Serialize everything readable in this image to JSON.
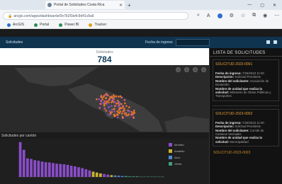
{
  "browser": {
    "tab_title": "Portal de Solicitudes Costa Rica",
    "url": "arcgis.com/apps/dashboards/0e7b2f3a4c9d41c8a6",
    "bookmarks": [
      "ArcGIS",
      "Portal",
      "Power BI",
      "Tracker"
    ]
  },
  "header": {
    "title": "Solicitudes",
    "filter_label": "Fecha de ingreso"
  },
  "kpi": {
    "label": "Solicitudes",
    "value": "784"
  },
  "chart": {
    "title": "Solicitudes por cantón"
  },
  "chart_data": {
    "type": "bar",
    "ylabel": "",
    "xlabel": "",
    "ylim": [
      0,
      120
    ],
    "colors": [
      "#8a4dc9",
      "#c9b230",
      "#4a8bd6",
      "#3aa17e"
    ],
    "values": [
      118,
      92,
      63,
      61,
      57,
      55,
      52,
      50,
      49,
      47,
      45,
      44,
      43,
      41,
      38,
      36,
      33,
      30,
      26,
      22,
      18,
      15,
      12,
      10,
      8,
      6,
      5,
      4,
      3,
      3,
      2,
      2,
      2,
      1,
      1,
      1,
      1,
      1,
      1,
      1
    ],
    "series_index": [
      0,
      0,
      0,
      0,
      0,
      0,
      0,
      0,
      0,
      0,
      0,
      0,
      0,
      0,
      0,
      0,
      0,
      0,
      0,
      0,
      1,
      1,
      1,
      0,
      0,
      1,
      2,
      2,
      2,
      3,
      3,
      3,
      3,
      3,
      3,
      3,
      3,
      3,
      3,
      3
    ]
  },
  "legend": [
    {
      "label": "Morado",
      "color": "#8a4dc9"
    },
    {
      "label": "Amarillo",
      "color": "#c9b230"
    },
    {
      "label": "Azul",
      "color": "#4a8bd6"
    },
    {
      "label": "Verde",
      "color": "#3aa17e"
    }
  ],
  "panel": {
    "title": "LISTA DE SOLICITUDES",
    "cards": [
      {
        "id": "SOLICITUD-2023-0001",
        "fecha_label": "Fecha de ingreso:",
        "fecha": "7/26/2023 11:00",
        "desc_label": "Descripción:",
        "desc": "Solicitud Pendiente",
        "nombre_label": "Nombre del solicitante:",
        "nombre": "Asociación de Desarrollo",
        "unidad_label": "Nombre de unidad que realiza la solicitud:",
        "unidad": "Ministerio de Obras Públicas y Transportes"
      },
      {
        "id": "SOLICITUD-2023-0002",
        "fecha_label": "Fecha de ingreso:",
        "fecha": "7/26/2023 11:00",
        "desc_label": "Descripción:",
        "desc": "Solicitud Pendiente",
        "nombre_label": "Nombre del solicitante:",
        "nombre": "Comité de Caminos Vecinales",
        "unidad_label": "Nombre de unidad que realiza la solicitud:",
        "unidad": "Municipalidad"
      }
    ],
    "more": "SOLICITUD-2023-0003"
  }
}
